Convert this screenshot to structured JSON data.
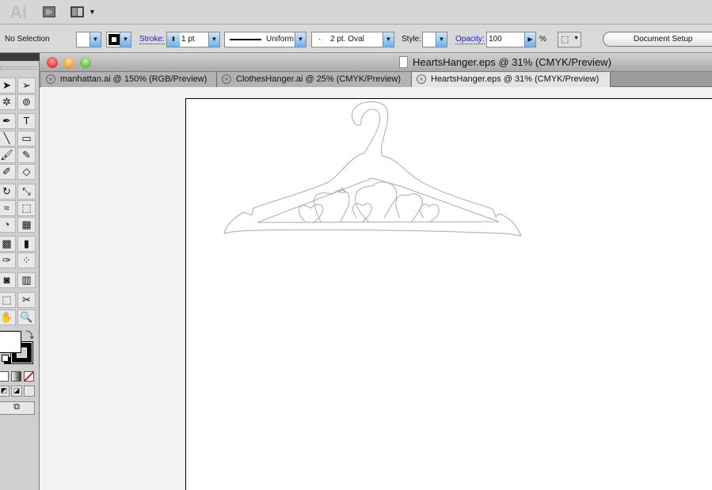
{
  "appbar": {
    "logo": "Ai",
    "bridge": "Br",
    "arrange_icon": "arrange-documents-icon"
  },
  "control": {
    "selection": "No Selection",
    "stroke_label": "Stroke:",
    "stroke_weight": "1 pt",
    "profile": "Uniform",
    "brush": "2 pt. Oval",
    "brush_dot": "·",
    "style_label": "Style:",
    "opacity_label": "Opacity:",
    "opacity": "100",
    "percent": "%",
    "document_setup": "Document Setup"
  },
  "window": {
    "title": "HeartsHanger.eps @ 31% (CMYK/Preview)"
  },
  "tabs": [
    {
      "label": "manhattan.ai @ 150% (RGB/Preview)"
    },
    {
      "label": "ClothesHanger.ai @ 25% (CMYK/Preview)"
    },
    {
      "label": "HeartsHanger.eps @ 31% (CMYK/Preview)",
      "active": true
    }
  ],
  "tools": [
    [
      "selection",
      "direct-selection"
    ],
    [
      "magic-wand",
      "lasso"
    ],
    [
      "pen",
      "type"
    ],
    [
      "line-segment",
      "rectangle"
    ],
    [
      "paintbrush",
      "pencil"
    ],
    [
      "blob-brush",
      "eraser"
    ],
    [
      "rotate",
      "scale"
    ],
    [
      "warp",
      "free-transform"
    ],
    [
      "shape-builder",
      "perspective-grid"
    ],
    [
      "mesh",
      "gradient"
    ],
    [
      "eyedropper",
      "blend"
    ],
    [
      "symbol-sprayer",
      "column-graph"
    ],
    [
      "artboard",
      "slice"
    ],
    [
      "hand",
      "zoom"
    ]
  ],
  "tool_glyphs": [
    [
      "➤",
      "➢"
    ],
    [
      "✲",
      "⊚"
    ],
    [
      "✒",
      "T"
    ],
    [
      "╲",
      "▭"
    ],
    [
      "🖌",
      "✎"
    ],
    [
      "✐",
      "◇"
    ],
    [
      "↻",
      "⤡"
    ],
    [
      "≈",
      "⬚"
    ],
    [
      "◔",
      "▦"
    ],
    [
      "▩",
      "▮"
    ],
    [
      "✑",
      "⁘"
    ],
    [
      "◙",
      "▥"
    ],
    [
      "⬚",
      "✂"
    ],
    [
      "✋",
      "🔍"
    ]
  ],
  "colors": {
    "fill": "#ffffff",
    "stroke": "#000000",
    "accent": "#6fb1ec"
  }
}
